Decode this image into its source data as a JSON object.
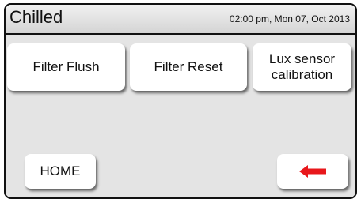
{
  "header": {
    "title": "Chilled",
    "datetime": "02:00 pm, Mon 07, Oct 2013"
  },
  "buttons": {
    "filter_flush": "Filter Flush",
    "filter_reset": "Filter Reset",
    "lux_line1": "Lux sensor",
    "lux_line2": "calibration",
    "home": "HOME"
  },
  "icons": {
    "back": "back-arrow-icon"
  },
  "colors": {
    "arrow_red": "#e8171b",
    "screen_bg": "#e4e4e4"
  }
}
